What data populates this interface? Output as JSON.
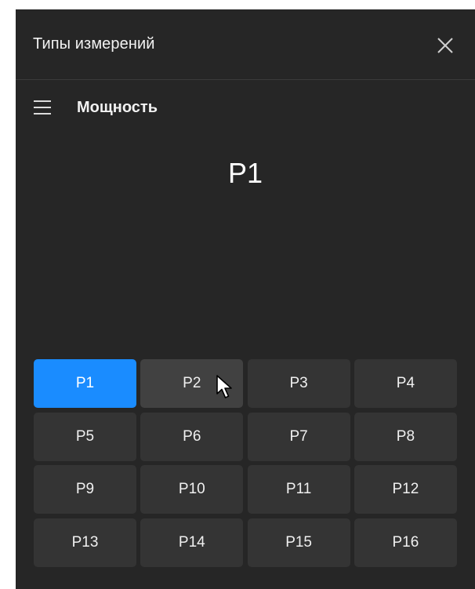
{
  "dialog": {
    "title": "Типы измерений"
  },
  "section": {
    "title": "Мощность"
  },
  "selected": {
    "label": "P1"
  },
  "ports": [
    {
      "label": "P1",
      "state": "active"
    },
    {
      "label": "P2",
      "state": "hover"
    },
    {
      "label": "P3",
      "state": "normal"
    },
    {
      "label": "P4",
      "state": "normal"
    },
    {
      "label": "P5",
      "state": "normal"
    },
    {
      "label": "P6",
      "state": "normal"
    },
    {
      "label": "P7",
      "state": "normal"
    },
    {
      "label": "P8",
      "state": "normal"
    },
    {
      "label": "P9",
      "state": "normal"
    },
    {
      "label": "P10",
      "state": "normal"
    },
    {
      "label": "P11",
      "state": "normal"
    },
    {
      "label": "P12",
      "state": "normal"
    },
    {
      "label": "P13",
      "state": "normal"
    },
    {
      "label": "P14",
      "state": "normal"
    },
    {
      "label": "P15",
      "state": "normal"
    },
    {
      "label": "P16",
      "state": "normal"
    }
  ],
  "icons": {
    "close": "close-icon",
    "menu": "hamburger-menu-icon",
    "cursor": "mouse-pointer-icon"
  },
  "colors": {
    "background": "#262626",
    "button": "#343434",
    "button_hover": "#414141",
    "accent": "#1a8cff"
  }
}
